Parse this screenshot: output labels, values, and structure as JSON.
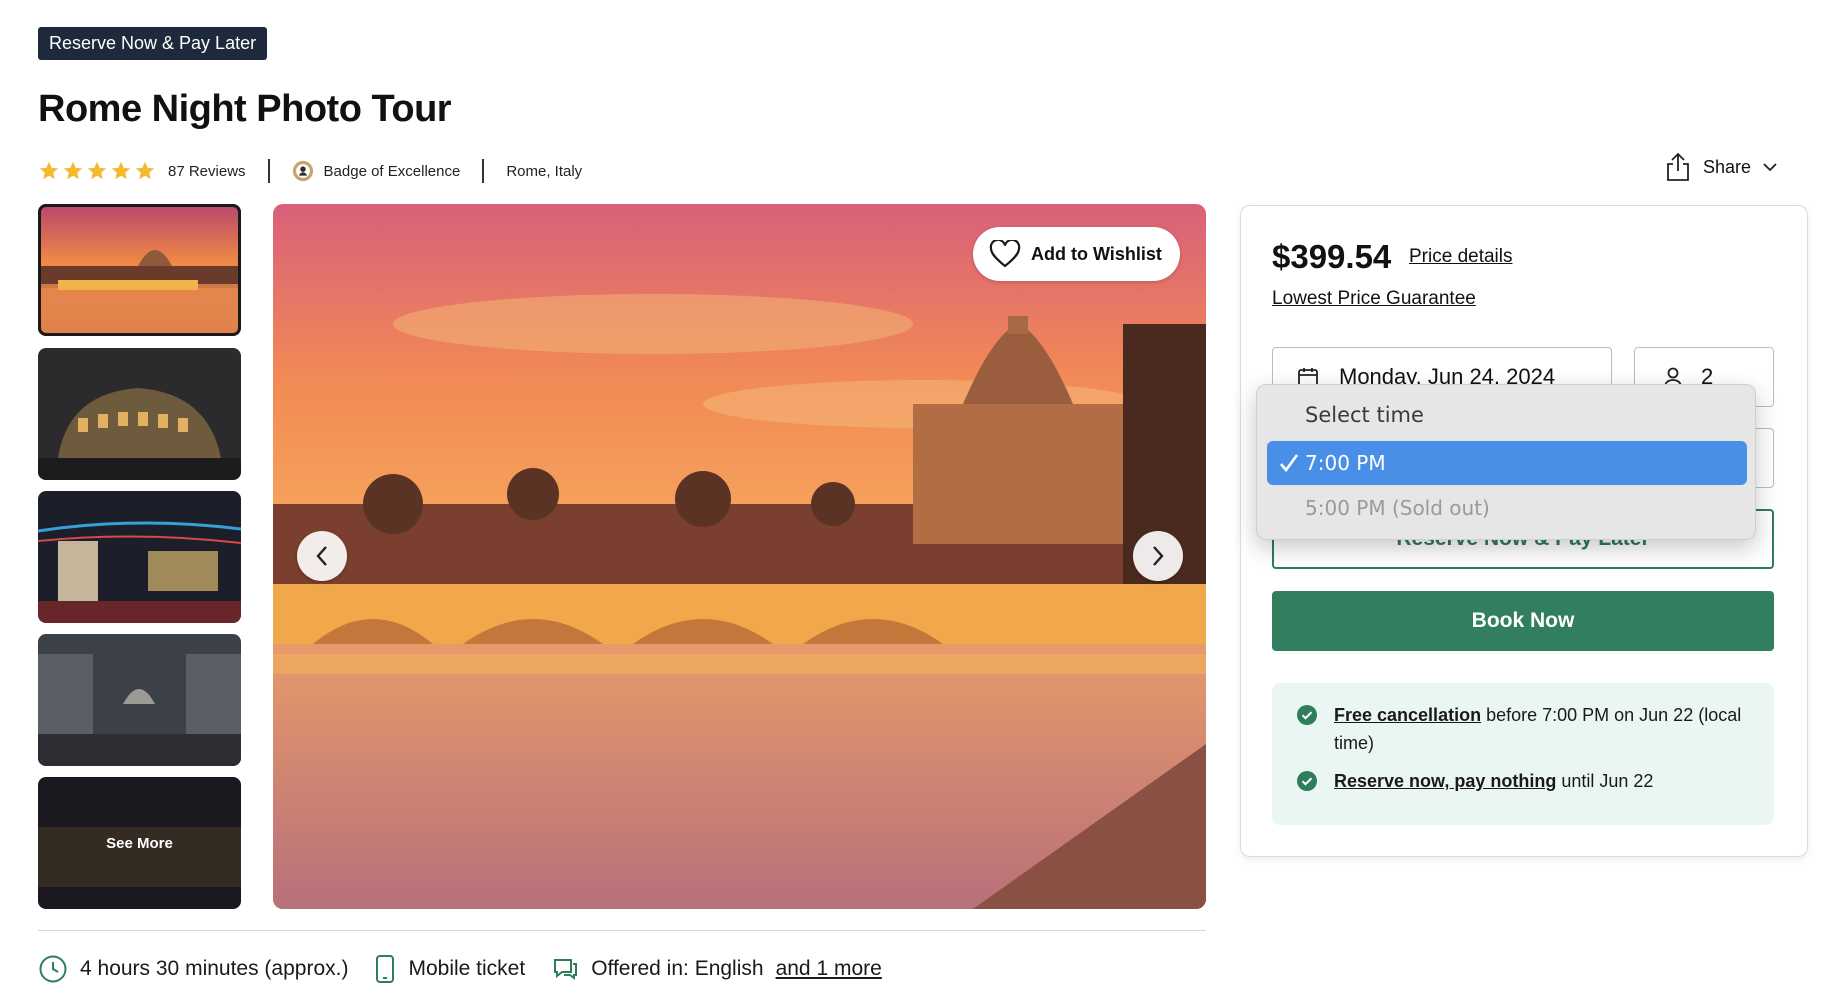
{
  "badge_tag": "Reserve Now & Pay Later",
  "title": "Rome Night Photo Tour",
  "rating": {
    "stars": 5,
    "reviews": "87 Reviews"
  },
  "badge": "Badge of Excellence",
  "location": "Rome, Italy",
  "share_label": "Share",
  "gallery": {
    "thumbnails": [
      "thumb-1",
      "thumb-2",
      "thumb-3",
      "thumb-4",
      "thumb-5"
    ],
    "see_more": "See More",
    "wishlist_label": "Add to Wishlist"
  },
  "features": {
    "duration": "4 hours 30 minutes (approx.)",
    "ticket": "Mobile ticket",
    "language_prefix": "Offered in: English",
    "language_link": "and 1 more"
  },
  "booking": {
    "price": "$399.54",
    "price_details": "Price details",
    "lowest_price": "Lowest Price Guarantee",
    "date": "Monday, Jun 24, 2024",
    "travelers": "2",
    "reserve_label": "Reserve Now & Pay Later",
    "book_label": "Book Now",
    "cancellation_link": "Free cancellation",
    "cancellation_text": " before 7:00 PM on Jun 22 (local time)",
    "pay_link": "Reserve now, pay nothing",
    "pay_text": " until Jun 22"
  },
  "time_dropdown": {
    "header": "Select time",
    "options": [
      {
        "label": "7:00 PM",
        "selected": true,
        "disabled": false
      },
      {
        "label": "5:00 PM (Sold out)",
        "selected": false,
        "disabled": true
      }
    ]
  },
  "colors": {
    "primary_green": "#327f5f",
    "tag_bg": "#1e2a3c",
    "star": "#f5b82e",
    "select_blue": "#4a8fe7",
    "info_bg": "#eaf6f3"
  }
}
